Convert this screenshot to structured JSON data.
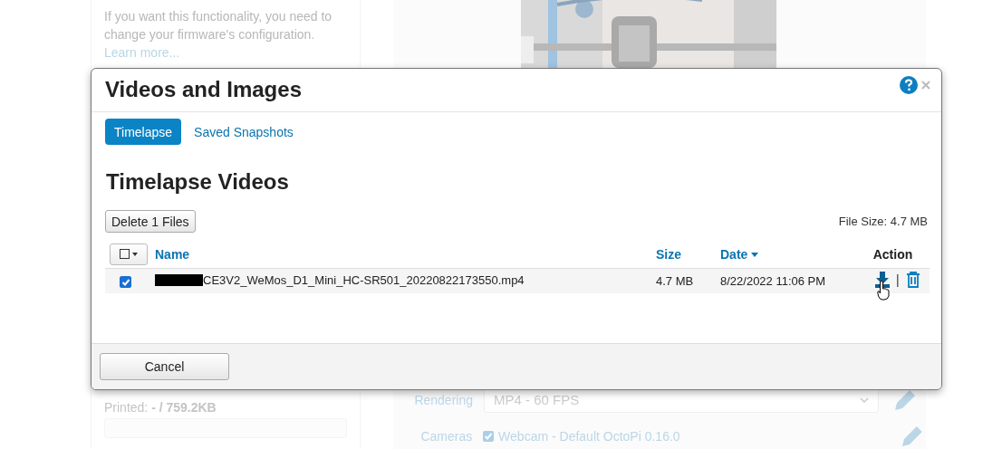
{
  "background": {
    "notice": "If you want this functionality, you need to change your firmware's configuration.",
    "learn_more": "Learn more...",
    "printed": {
      "label": "Printed:",
      "value": "- / 759.2KB"
    },
    "rendering": {
      "label": "Rendering",
      "value": "MP4 - 60 FPS"
    },
    "cameras": {
      "label": "Cameras",
      "checked": true,
      "camera": "Webcam - Default OctoPi 0.16.0"
    }
  },
  "dialog": {
    "title": "Videos and Images",
    "tabs": [
      {
        "label": "Timelapse",
        "selected": true
      },
      {
        "label": "Saved Snapshots",
        "selected": false
      }
    ],
    "heading": "Timelapse Videos",
    "delete_button": "Delete 1 Files",
    "file_size": "File Size: 4.7 MB",
    "table": {
      "columns": [
        {
          "label": "Name",
          "kind": "link",
          "sorted": false
        },
        {
          "label": "Size",
          "kind": "link",
          "sorted": false
        },
        {
          "label": "Date",
          "kind": "link",
          "sorted": true
        },
        {
          "label": "Action",
          "kind": "plain",
          "sorted": false
        }
      ],
      "rows": [
        {
          "selected": true,
          "name_redacted": true,
          "name": "CE3V2_WeMos_D1_Mini_HC-SR501_20220822173550.mp4",
          "size": "4.7 MB",
          "date": "8/22/2022 11:06 PM",
          "action_separator": "|"
        }
      ]
    },
    "cancel_button": "Cancel"
  }
}
